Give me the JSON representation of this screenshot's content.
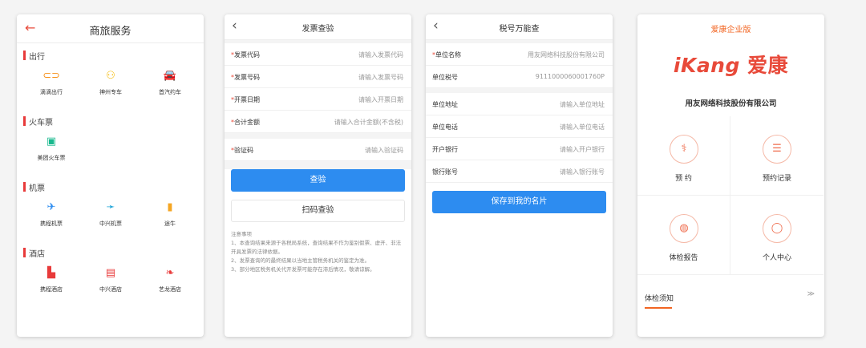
{
  "screen1": {
    "title": "商旅服务",
    "sections": [
      {
        "title": "出行",
        "items": [
          {
            "label": "滴滴出行",
            "icon": "taxi-ring-icon",
            "glyph": "⊂⊃",
            "color": "#f7931e"
          },
          {
            "label": "神州专车",
            "icon": "car-icon",
            "glyph": "⚇",
            "color": "#f5b800"
          },
          {
            "label": "首汽约车",
            "icon": "car-icon",
            "glyph": "🚘",
            "color": "#e83a3a"
          }
        ]
      },
      {
        "title": "火车票",
        "items": [
          {
            "label": "美团火车票",
            "icon": "train-icon",
            "glyph": "▣",
            "color": "#19b98e"
          }
        ]
      },
      {
        "title": "机票",
        "items": [
          {
            "label": "携程机票",
            "icon": "plane-icon",
            "glyph": "✈",
            "color": "#2d8cf0"
          },
          {
            "label": "中兴机票",
            "icon": "plane-icon",
            "glyph": "➛",
            "color": "#1ea4d8"
          },
          {
            "label": "途牛",
            "icon": "medal-icon",
            "glyph": "▮",
            "color": "#f5a623"
          }
        ]
      },
      {
        "title": "酒店",
        "items": [
          {
            "label": "携程酒店",
            "icon": "hotel-icon",
            "glyph": "▙",
            "color": "#e83a3a"
          },
          {
            "label": "中兴酒店",
            "icon": "hotel-icon",
            "glyph": "▤",
            "color": "#e83a3a"
          },
          {
            "label": "艺龙酒店",
            "icon": "elong-icon",
            "glyph": "❧",
            "color": "#e83a3a"
          }
        ]
      }
    ]
  },
  "screen2": {
    "title": "发票查验",
    "fields": [
      {
        "label": "发票代码",
        "placeholder": "请输入发票代码"
      },
      {
        "label": "发票号码",
        "placeholder": "请输入发票号码"
      },
      {
        "label": "开票日期",
        "placeholder": "请输入开票日期"
      },
      {
        "label": "合计金额",
        "placeholder": "请输入合计金额(不含税)"
      }
    ],
    "verify": {
      "label": "验证码",
      "placeholder": "请输入验证码"
    },
    "check_button": "查验",
    "scan_button": "扫码查验",
    "notes": [
      "注意事项",
      "1、本查询结果来源于各税局系统，查询结果不作为鉴别假票、虚开、非法开具发票的法律依据。",
      "2、发票查询的的最终结果以当地主管税务机关的鉴定为准。",
      "3、部分地区税务机关代开发票可能存在滞后情况，敬请谅解。"
    ]
  },
  "screen3": {
    "title": "税号万能查",
    "group1": [
      {
        "label": "单位名称",
        "value": "用友网络科技股份有限公司",
        "required": true
      },
      {
        "label": "单位税号",
        "value": "9111000060001760P",
        "required": false
      }
    ],
    "group2": [
      {
        "label": "单位地址",
        "value": "请输入单位地址"
      },
      {
        "label": "单位电话",
        "value": "请输入单位电话"
      },
      {
        "label": "开户银行",
        "value": "请输入开户银行"
      },
      {
        "label": "银行账号",
        "value": "请输入银行账号"
      }
    ],
    "save_button": "保存到我的名片"
  },
  "screen4": {
    "brand": "爱康企业版",
    "logo_latin": "iKang",
    "logo_cn": "爱康",
    "company": "用友网络科技股份有限公司",
    "tiles": [
      {
        "label": "预  约",
        "icon": "stethoscope-icon",
        "glyph": "⚕"
      },
      {
        "label": "预约记录",
        "icon": "record-icon",
        "glyph": "☰"
      },
      {
        "label": "体检报告",
        "icon": "report-icon",
        "glyph": "◍"
      },
      {
        "label": "个人中心",
        "icon": "person-icon",
        "glyph": "◯"
      }
    ],
    "tips": "体检须知",
    "tips_arrow": "≫"
  }
}
